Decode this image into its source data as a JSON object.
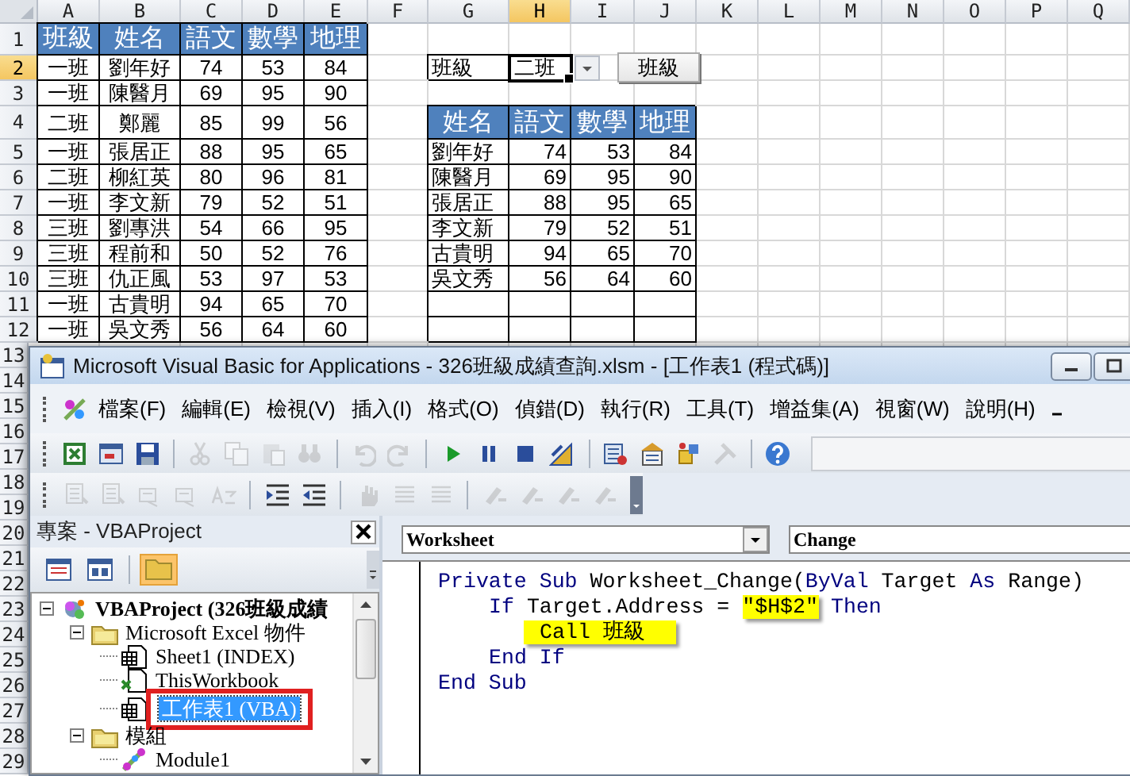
{
  "sheet": {
    "columns": [
      {
        "label": "A",
        "selected": false
      },
      {
        "label": "B",
        "selected": false
      },
      {
        "label": "C",
        "selected": false
      },
      {
        "label": "D",
        "selected": false
      },
      {
        "label": "E",
        "selected": false
      },
      {
        "label": "F",
        "selected": false
      },
      {
        "label": "G",
        "selected": false
      },
      {
        "label": "H",
        "selected": true
      },
      {
        "label": "I",
        "selected": false
      },
      {
        "label": "J",
        "selected": false
      },
      {
        "label": "K",
        "selected": false
      },
      {
        "label": "L",
        "selected": false
      },
      {
        "label": "M",
        "selected": false
      },
      {
        "label": "N",
        "selected": false
      },
      {
        "label": "O",
        "selected": false
      },
      {
        "label": "P",
        "selected": false
      },
      {
        "label": "Q",
        "selected": false
      }
    ],
    "rows": [
      {
        "number": "1",
        "selected": false,
        "cells": [
          {
            "text": "班級",
            "kind": "head"
          },
          {
            "text": "姓名",
            "kind": "head"
          },
          {
            "text": "語文",
            "kind": "head"
          },
          {
            "text": "數學",
            "kind": "head"
          },
          {
            "text": "地理",
            "kind": "head"
          }
        ]
      },
      {
        "number": "2",
        "selected": true,
        "cells": [
          {
            "text": "一班",
            "kind": "center"
          },
          {
            "text": "劉年好",
            "kind": "center"
          },
          {
            "text": "74",
            "kind": "center"
          },
          {
            "text": "53",
            "kind": "center"
          },
          {
            "text": "84",
            "kind": "center"
          },
          null,
          {
            "text": "班級",
            "kind": "text"
          },
          {
            "text": "二班",
            "kind": "dropdown"
          }
        ]
      },
      {
        "number": "3",
        "selected": false,
        "cells": [
          {
            "text": "一班",
            "kind": "center"
          },
          {
            "text": "陳醫月",
            "kind": "center"
          },
          {
            "text": "69",
            "kind": "center"
          },
          {
            "text": "95",
            "kind": "center"
          },
          {
            "text": "90",
            "kind": "center"
          }
        ]
      },
      {
        "number": "4",
        "selected": false,
        "cells": [
          {
            "text": "二班",
            "kind": "center"
          },
          {
            "text": "鄭麗",
            "kind": "center"
          },
          {
            "text": "85",
            "kind": "center"
          },
          {
            "text": "99",
            "kind": "center"
          },
          {
            "text": "56",
            "kind": "center"
          },
          null,
          {
            "text": "姓名",
            "kind": "head"
          },
          {
            "text": "語文",
            "kind": "head"
          },
          {
            "text": "數學",
            "kind": "head"
          },
          {
            "text": "地理",
            "kind": "head"
          }
        ]
      },
      {
        "number": "5",
        "selected": false,
        "cells": [
          {
            "text": "一班",
            "kind": "center"
          },
          {
            "text": "張居正",
            "kind": "center"
          },
          {
            "text": "88",
            "kind": "center"
          },
          {
            "text": "95",
            "kind": "center"
          },
          {
            "text": "65",
            "kind": "center"
          },
          null,
          {
            "text": "劉年好",
            "kind": "text"
          },
          {
            "text": "74",
            "kind": "number"
          },
          {
            "text": "53",
            "kind": "number"
          },
          {
            "text": "84",
            "kind": "number"
          }
        ]
      },
      {
        "number": "6",
        "selected": false,
        "cells": [
          {
            "text": "二班",
            "kind": "center"
          },
          {
            "text": "柳紅英",
            "kind": "center"
          },
          {
            "text": "80",
            "kind": "center"
          },
          {
            "text": "96",
            "kind": "center"
          },
          {
            "text": "81",
            "kind": "center"
          },
          null,
          {
            "text": "陳醫月",
            "kind": "text"
          },
          {
            "text": "69",
            "kind": "number"
          },
          {
            "text": "95",
            "kind": "number"
          },
          {
            "text": "90",
            "kind": "number"
          }
        ]
      },
      {
        "number": "7",
        "selected": false,
        "cells": [
          {
            "text": "一班",
            "kind": "center"
          },
          {
            "text": "李文新",
            "kind": "center"
          },
          {
            "text": "79",
            "kind": "center"
          },
          {
            "text": "52",
            "kind": "center"
          },
          {
            "text": "51",
            "kind": "center"
          },
          null,
          {
            "text": "張居正",
            "kind": "text"
          },
          {
            "text": "88",
            "kind": "number"
          },
          {
            "text": "95",
            "kind": "number"
          },
          {
            "text": "65",
            "kind": "number"
          }
        ]
      },
      {
        "number": "8",
        "selected": false,
        "cells": [
          {
            "text": "三班",
            "kind": "center"
          },
          {
            "text": "劉專洪",
            "kind": "center"
          },
          {
            "text": "54",
            "kind": "center"
          },
          {
            "text": "66",
            "kind": "center"
          },
          {
            "text": "95",
            "kind": "center"
          },
          null,
          {
            "text": "李文新",
            "kind": "text"
          },
          {
            "text": "79",
            "kind": "number"
          },
          {
            "text": "52",
            "kind": "number"
          },
          {
            "text": "51",
            "kind": "number"
          }
        ]
      },
      {
        "number": "9",
        "selected": false,
        "cells": [
          {
            "text": "三班",
            "kind": "center"
          },
          {
            "text": "程前和",
            "kind": "center"
          },
          {
            "text": "50",
            "kind": "center"
          },
          {
            "text": "52",
            "kind": "center"
          },
          {
            "text": "76",
            "kind": "center"
          },
          null,
          {
            "text": "古貴明",
            "kind": "text"
          },
          {
            "text": "94",
            "kind": "number"
          },
          {
            "text": "65",
            "kind": "number"
          },
          {
            "text": "70",
            "kind": "number"
          }
        ]
      },
      {
        "number": "10",
        "selected": false,
        "cells": [
          {
            "text": "三班",
            "kind": "center"
          },
          {
            "text": "仇正風",
            "kind": "center"
          },
          {
            "text": "53",
            "kind": "center"
          },
          {
            "text": "97",
            "kind": "center"
          },
          {
            "text": "53",
            "kind": "center"
          },
          null,
          {
            "text": "吳文秀",
            "kind": "text"
          },
          {
            "text": "56",
            "kind": "number"
          },
          {
            "text": "64",
            "kind": "number"
          },
          {
            "text": "60",
            "kind": "number"
          }
        ]
      },
      {
        "number": "11",
        "selected": false,
        "cells": [
          {
            "text": "一班",
            "kind": "center"
          },
          {
            "text": "古貴明",
            "kind": "center"
          },
          {
            "text": "94",
            "kind": "center"
          },
          {
            "text": "65",
            "kind": "center"
          },
          {
            "text": "70",
            "kind": "center"
          },
          null,
          {
            "kind": "blank"
          },
          {
            "kind": "blank"
          },
          {
            "kind": "blank"
          },
          {
            "kind": "blank"
          }
        ]
      },
      {
        "number": "12",
        "selected": false,
        "cells": [
          {
            "text": "一班",
            "kind": "center"
          },
          {
            "text": "吳文秀",
            "kind": "center"
          },
          {
            "text": "56",
            "kind": "center"
          },
          {
            "text": "64",
            "kind": "center"
          },
          {
            "text": "60",
            "kind": "center"
          },
          null,
          {
            "kind": "blank"
          },
          {
            "kind": "blank"
          },
          {
            "kind": "blank"
          },
          {
            "kind": "blank"
          }
        ]
      },
      {
        "number": "13",
        "selected": false
      },
      {
        "number": "14",
        "selected": false
      },
      {
        "number": "15",
        "selected": false
      },
      {
        "number": "16",
        "selected": false
      },
      {
        "number": "17",
        "selected": false
      },
      {
        "number": "18",
        "selected": false
      },
      {
        "number": "19",
        "selected": false
      },
      {
        "number": "20",
        "selected": false
      },
      {
        "number": "21",
        "selected": false
      },
      {
        "number": "22",
        "selected": false
      },
      {
        "number": "23",
        "selected": false
      },
      {
        "number": "24",
        "selected": false
      },
      {
        "number": "25",
        "selected": false
      },
      {
        "number": "26",
        "selected": false
      },
      {
        "number": "27",
        "selected": false
      },
      {
        "number": "28",
        "selected": false
      },
      {
        "number": "29",
        "selected": false
      }
    ],
    "form_button": {
      "label": "班級"
    }
  },
  "vba_window": {
    "title": "Microsoft Visual Basic for Applications - 326班級成績查詢.xlsm - [工作表1 (程式碼)]",
    "menus": [
      "檔案(F)",
      "編輯(E)",
      "檢視(V)",
      "插入(I)",
      "格式(O)",
      "偵錯(D)",
      "執行(R)",
      "工具(T)",
      "增益集(A)",
      "視窗(W)",
      "說明(H)"
    ],
    "standard_toolbar": [
      {
        "kind": "excel",
        "disabled": false
      },
      {
        "kind": "form",
        "disabled": false
      },
      {
        "kind": "save",
        "disabled": false
      },
      {
        "kind": "separator"
      },
      {
        "kind": "cut",
        "disabled": true
      },
      {
        "kind": "copy",
        "disabled": true
      },
      {
        "kind": "paste",
        "disabled": true
      },
      {
        "kind": "find",
        "disabled": true
      },
      {
        "kind": "separator"
      },
      {
        "kind": "undo",
        "disabled": true
      },
      {
        "kind": "redo",
        "disabled": true
      },
      {
        "kind": "separator"
      },
      {
        "kind": "run",
        "disabled": false
      },
      {
        "kind": "pause",
        "disabled": false
      },
      {
        "kind": "stop",
        "disabled": false
      },
      {
        "kind": "design",
        "disabled": false
      },
      {
        "kind": "separator"
      },
      {
        "kind": "project",
        "disabled": false
      },
      {
        "kind": "properties",
        "disabled": false
      },
      {
        "kind": "browser",
        "disabled": false
      },
      {
        "kind": "tools",
        "disabled": true
      },
      {
        "kind": "separator"
      },
      {
        "kind": "help",
        "disabled": false
      }
    ],
    "edit_toolbar": [
      {
        "kind": "list",
        "disabled": true
      },
      {
        "kind": "list",
        "disabled": true
      },
      {
        "kind": "info",
        "disabled": true
      },
      {
        "kind": "info",
        "disabled": true
      },
      {
        "kind": "word",
        "disabled": true
      },
      {
        "kind": "separator"
      },
      {
        "kind": "indent",
        "disabled": false
      },
      {
        "kind": "outdent",
        "disabled": false
      },
      {
        "kind": "separator"
      },
      {
        "kind": "hand",
        "disabled": true
      },
      {
        "kind": "lines",
        "disabled": true
      },
      {
        "kind": "lines",
        "disabled": true
      },
      {
        "kind": "separator"
      },
      {
        "kind": "bookmark",
        "disabled": true
      },
      {
        "kind": "bookmark",
        "disabled": true
      },
      {
        "kind": "bookmark",
        "disabled": true
      },
      {
        "kind": "bookmark",
        "disabled": true
      }
    ],
    "project_panel": {
      "title": "專案 - VBAProject",
      "tree": [
        {
          "label": "VBAProject (326班級成績",
          "kind": "project",
          "expanded": true,
          "selected": false,
          "highlighted": false,
          "children": [
            {
              "label": "Microsoft Excel 物件",
              "kind": "folder",
              "expanded": true,
              "selected": false,
              "highlighted": false,
              "children": [
                {
                  "label": "Sheet1 (INDEX)",
                  "kind": "sheet",
                  "selected": false,
                  "highlighted": false
                },
                {
                  "label": "ThisWorkbook",
                  "kind": "workbook",
                  "selected": false,
                  "highlighted": false
                },
                {
                  "label": "工作表1 (VBA)",
                  "kind": "sheet",
                  "selected": true,
                  "highlighted": true
                }
              ]
            },
            {
              "label": "模組",
              "kind": "folder",
              "expanded": true,
              "selected": false,
              "highlighted": false,
              "children": [
                {
                  "label": "Module1",
                  "kind": "module",
                  "selected": false,
                  "highlighted": false
                }
              ]
            }
          ]
        }
      ]
    },
    "code_pane": {
      "object": "Worksheet",
      "procedure": "Change",
      "lines": [
        {
          "segments": [
            {
              "text": "Private Sub",
              "kind": "keyword"
            },
            {
              "text": " Worksheet_Change(",
              "kind": "plain"
            },
            {
              "text": "ByVal",
              "kind": "keyword"
            },
            {
              "text": " Target ",
              "kind": "plain"
            },
            {
              "text": "As",
              "kind": "keyword"
            },
            {
              "text": " Range)",
              "kind": "plain"
            }
          ],
          "children": [
            {
              "segments": [
                {
                  "text": "If",
                  "kind": "keyword"
                },
                {
                  "text": " Target.Address = ",
                  "kind": "plain"
                },
                {
                  "text": "\"$H$2\"",
                  "kind": "highlight"
                },
                {
                  "text": " Then",
                  "kind": "keyword"
                }
              ],
              "children": [
                {
                  "segments": [
                    {
                      "text": "Call 班級",
                      "kind": "callout"
                    }
                  ]
                }
              ]
            },
            {
              "segments": [
                {
                  "text": "End If",
                  "kind": "keyword"
                }
              ]
            }
          ]
        },
        {
          "segments": [
            {
              "text": "End Sub",
              "kind": "keyword"
            }
          ]
        }
      ]
    }
  }
}
